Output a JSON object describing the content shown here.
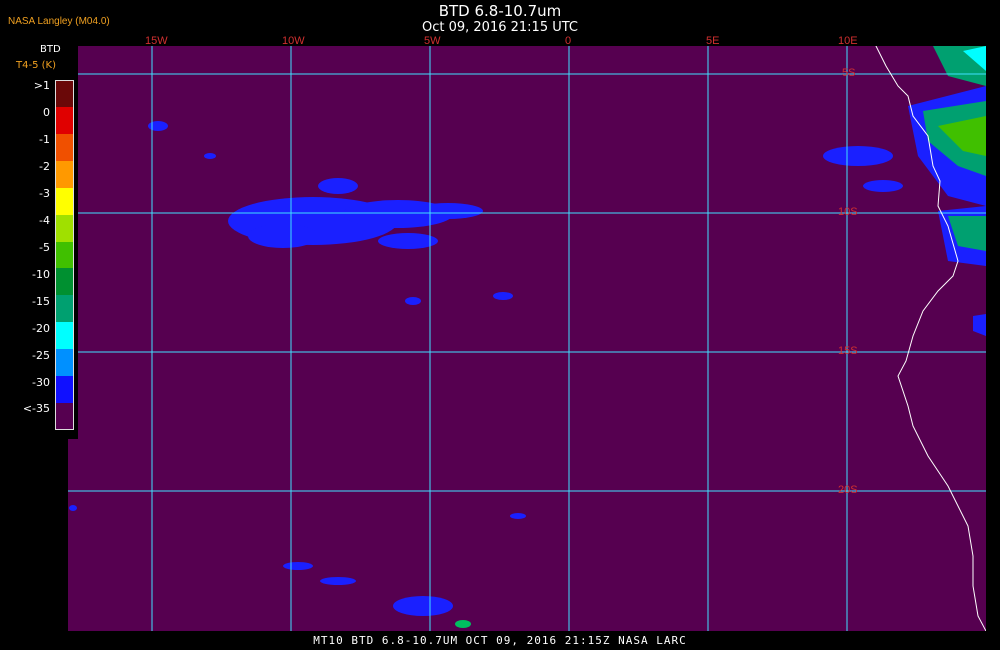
{
  "header": {
    "credit": "NASA Langley (M04.0)",
    "title": "BTD 6.8-10.7um",
    "subtitle": "Oct 09, 2016 21:15 UTC"
  },
  "legend": {
    "title": "BTD",
    "unit": "T4-5 (K)",
    "entries": [
      {
        "label": ">1",
        "color": "#6a0808"
      },
      {
        "label": "0",
        "color": "#e00000"
      },
      {
        "label": "-1",
        "color": "#f05000"
      },
      {
        "label": "-2",
        "color": "#ff9900"
      },
      {
        "label": "-3",
        "color": "#ffff00"
      },
      {
        "label": "-4",
        "color": "#a0e000"
      },
      {
        "label": "-5",
        "color": "#40c000"
      },
      {
        "label": "-10",
        "color": "#009030"
      },
      {
        "label": "-15",
        "color": "#00a070"
      },
      {
        "label": "-20",
        "color": "#00ffff"
      },
      {
        "label": "-25",
        "color": "#0090ff"
      },
      {
        "label": "-30",
        "color": "#1010ff"
      },
      {
        "label": "<-35",
        "color": "#560050"
      }
    ]
  },
  "map": {
    "background_color": "#560050",
    "grid_color": "#40e0ff",
    "coastline_color": "#ffffff",
    "longitude_labels": [
      "15W",
      "10W",
      "5W",
      "0",
      "5E",
      "10E"
    ],
    "latitude_labels": [
      "5S",
      "10S",
      "15S",
      "20S"
    ]
  },
  "footer": {
    "text": "MT10  BTD 6.8-10.7UM   OCT 09, 2016 21:15Z   NASA LARC"
  }
}
